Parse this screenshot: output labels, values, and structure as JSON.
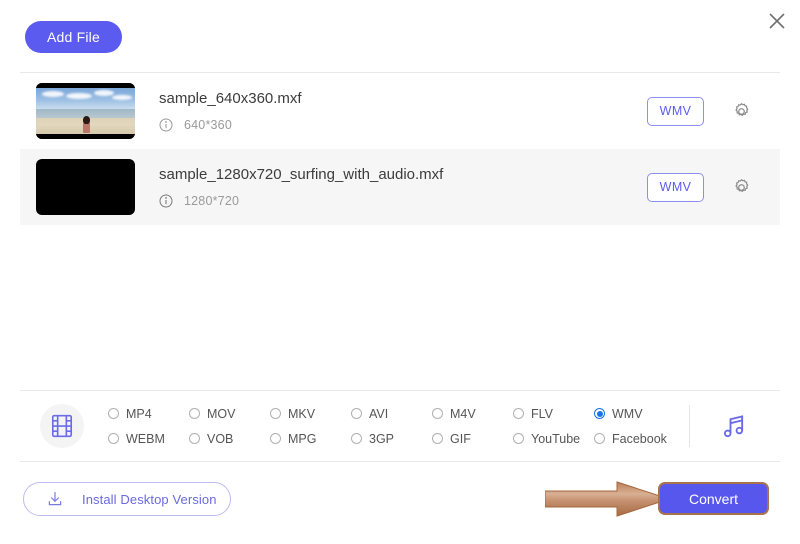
{
  "window": {
    "close_icon": "close-icon"
  },
  "toolbar": {
    "add_file_label": "Add File"
  },
  "files": [
    {
      "name": "sample_640x360.mxf",
      "resolution": "640*360",
      "format_label": "WMV",
      "thumbnail": "beach-scene-thumbnail",
      "settings_icon": "gear-icon",
      "info_icon": "info-icon"
    },
    {
      "name": "sample_1280x720_surfing_with_audio.mxf",
      "resolution": "1280*720",
      "format_label": "WMV",
      "thumbnail": "black-thumbnail",
      "settings_icon": "gear-icon",
      "info_icon": "info-icon"
    }
  ],
  "format_bar": {
    "video_icon": "film-strip-icon",
    "audio_icon": "music-note-icon",
    "selected_format": "WMV",
    "options": [
      {
        "label": "MP4",
        "selected": false
      },
      {
        "label": "MOV",
        "selected": false
      },
      {
        "label": "MKV",
        "selected": false
      },
      {
        "label": "AVI",
        "selected": false
      },
      {
        "label": "M4V",
        "selected": false
      },
      {
        "label": "FLV",
        "selected": false
      },
      {
        "label": "WMV",
        "selected": true
      },
      {
        "label": "WEBM",
        "selected": false
      },
      {
        "label": "VOB",
        "selected": false
      },
      {
        "label": "MPG",
        "selected": false
      },
      {
        "label": "3GP",
        "selected": false
      },
      {
        "label": "GIF",
        "selected": false
      },
      {
        "label": "YouTube",
        "selected": false
      },
      {
        "label": "Facebook",
        "selected": false
      }
    ]
  },
  "bottom": {
    "install_label": "Install Desktop Version",
    "install_icon": "download-icon",
    "convert_label": "Convert",
    "annotation": "arrow-pointing-to-convert"
  },
  "colors": {
    "accent_purple": "#5b5bf0",
    "radio_selected_blue": "#1a73e8",
    "row_shade": "#f6f6f6",
    "annotation_brown": "#b5784f",
    "convert_fill": "#5757ee"
  }
}
